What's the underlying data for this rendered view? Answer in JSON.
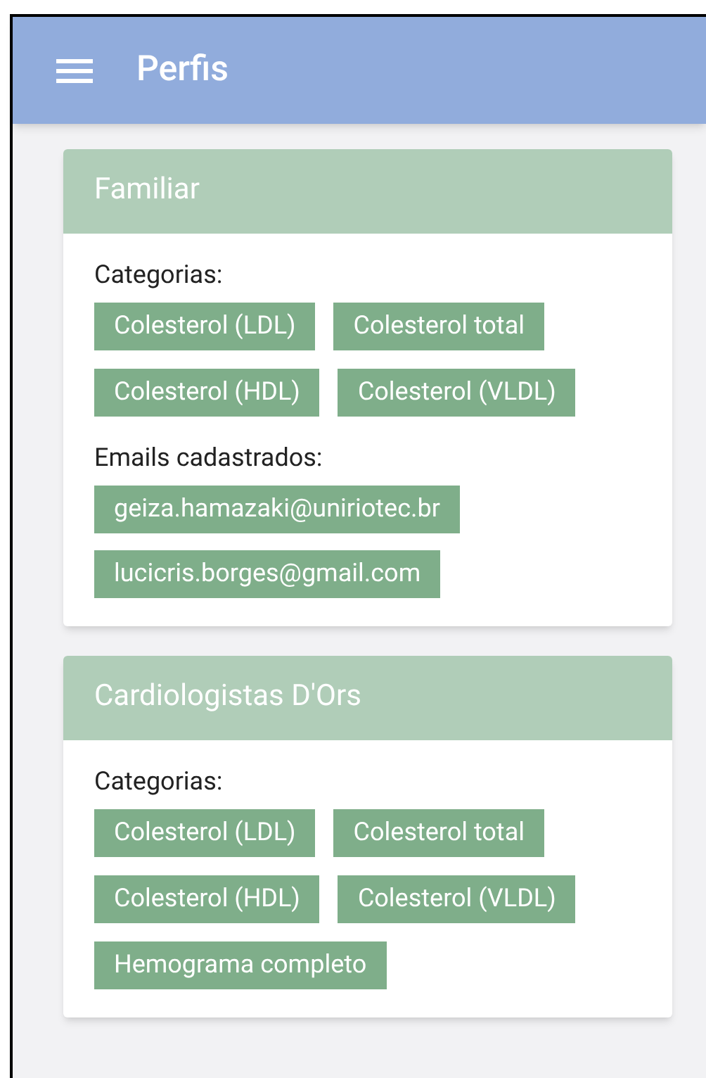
{
  "app_bar": {
    "title": "Perfis"
  },
  "profiles": [
    {
      "name": "Familiar",
      "sections": [
        {
          "label": "Categorias:",
          "kind": "category",
          "tags": [
            "Colesterol (LDL)",
            "Colesterol total",
            "Colesterol (HDL)",
            "Colesterol (VLDL)"
          ]
        },
        {
          "label": "Emails cadastrados:",
          "kind": "email",
          "tags": [
            "geiza.hamazaki@uniriotec.br",
            "lucicris.borges@gmail.com"
          ]
        }
      ]
    },
    {
      "name": "Cardiologistas D'Ors",
      "sections": [
        {
          "label": "Categorias:",
          "kind": "category",
          "tags": [
            "Colesterol (LDL)",
            "Colesterol total",
            "Colesterol (HDL)",
            "Colesterol (VLDL)",
            "Hemograma completo"
          ]
        }
      ]
    }
  ]
}
